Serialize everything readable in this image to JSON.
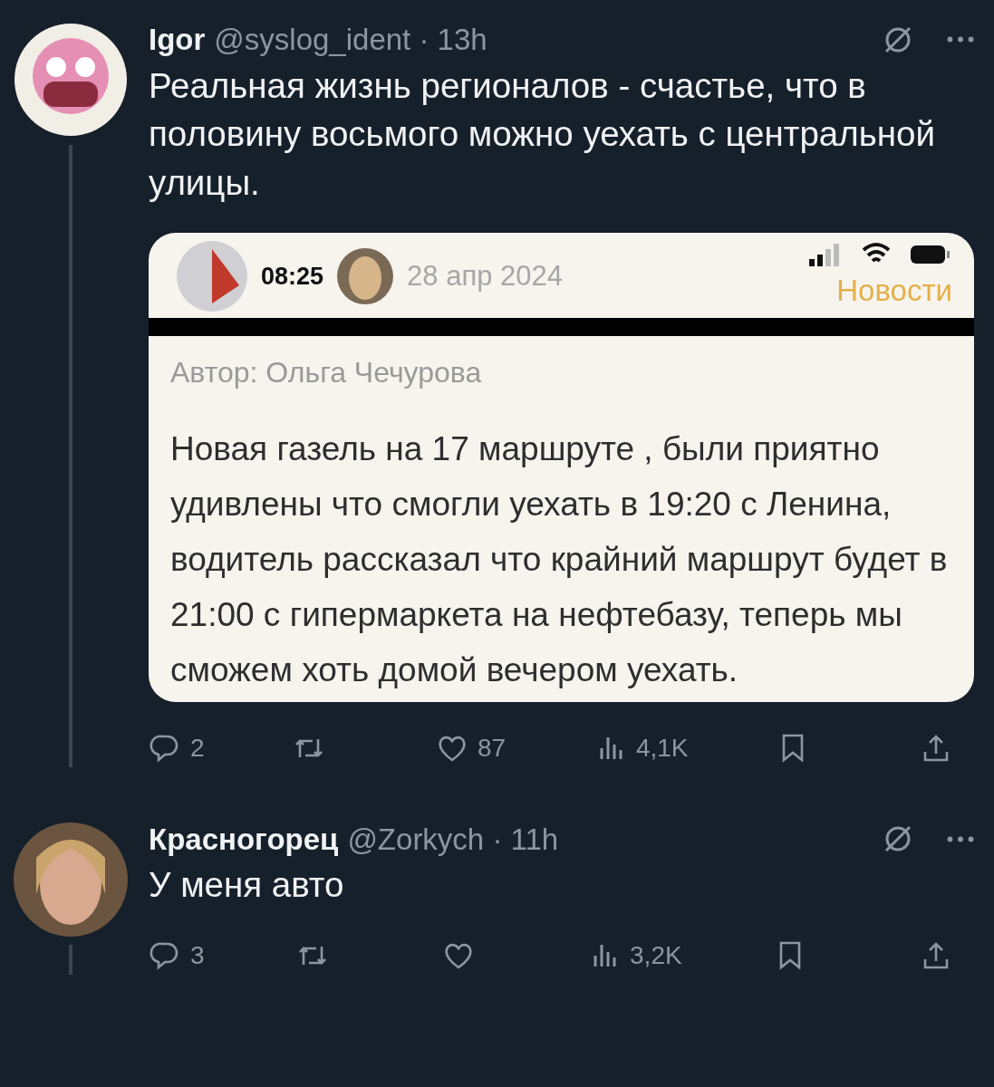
{
  "tweets": [
    {
      "name": "Igor",
      "handle_line": "@syslog_ident · 13h",
      "text": "Реальная жизнь регионалов - счастье, что в половину восьмого можно уехать с центральной улицы.",
      "thread_below": true,
      "media": {
        "status_time": "08:25",
        "date": "28 апр 2024",
        "category": "Новости",
        "author": "Автор: Ольга Чечурова",
        "body": "Новая газель на 17 маршруте , были приятно удивлены что смогли уехать в 19:20 с Ленина, водитель рассказал что крайний маршрут будет в 21:00 с гипермаркета на нефтебазу, теперь мы сможем хоть домой вечером уехать."
      },
      "actions": [
        {
          "kind": "reply",
          "count": "2"
        },
        {
          "kind": "retweet"
        },
        {
          "kind": "like",
          "count": "87"
        },
        {
          "kind": "views",
          "count": "4,1K"
        },
        {
          "kind": "bookmark"
        },
        {
          "kind": "share"
        }
      ]
    },
    {
      "name": "Красногорец",
      "handle_line": "@Zorkych · 11h",
      "text": "У меня авто",
      "thread_below": true,
      "actions": [
        {
          "kind": "reply",
          "count": "3"
        },
        {
          "kind": "retweet"
        },
        {
          "kind": "like"
        },
        {
          "kind": "views",
          "count": "3,2K"
        },
        {
          "kind": "bookmark"
        },
        {
          "kind": "share"
        }
      ]
    }
  ]
}
